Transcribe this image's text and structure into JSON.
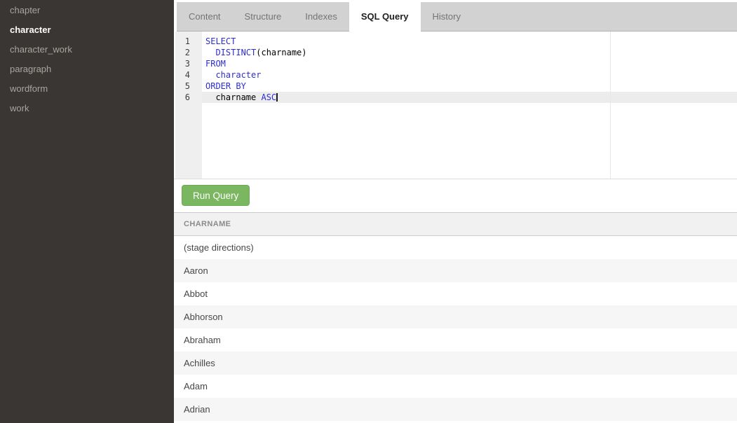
{
  "sidebar": {
    "items": [
      {
        "label": "chapter",
        "selected": false
      },
      {
        "label": "character",
        "selected": true
      },
      {
        "label": "character_work",
        "selected": false
      },
      {
        "label": "paragraph",
        "selected": false
      },
      {
        "label": "wordform",
        "selected": false
      },
      {
        "label": "work",
        "selected": false
      }
    ]
  },
  "tabs": {
    "items": [
      "Content",
      "Structure",
      "Indexes",
      "SQL Query",
      "History"
    ],
    "active": "SQL Query"
  },
  "editor": {
    "lines": [
      {
        "number": "1",
        "active": false,
        "cursor": false,
        "tokens": [
          {
            "text": "SELECT",
            "type": "keyword"
          }
        ]
      },
      {
        "number": "2",
        "active": false,
        "cursor": false,
        "tokens": [
          {
            "text": "  ",
            "type": "plain"
          },
          {
            "text": "DISTINCT",
            "type": "keyword"
          },
          {
            "text": "(charname)",
            "type": "plain"
          }
        ]
      },
      {
        "number": "3",
        "active": false,
        "cursor": false,
        "tokens": [
          {
            "text": "FROM",
            "type": "keyword"
          }
        ]
      },
      {
        "number": "4",
        "active": false,
        "cursor": false,
        "tokens": [
          {
            "text": "  ",
            "type": "plain"
          },
          {
            "text": "character",
            "type": "keyword"
          }
        ]
      },
      {
        "number": "5",
        "active": false,
        "cursor": false,
        "tokens": [
          {
            "text": "ORDER BY",
            "type": "keyword"
          }
        ]
      },
      {
        "number": "6",
        "active": true,
        "cursor": true,
        "tokens": [
          {
            "text": "  ",
            "type": "plain"
          },
          {
            "text": "charname ",
            "type": "plain"
          },
          {
            "text": "ASC",
            "type": "keyword"
          }
        ]
      }
    ]
  },
  "run_button": {
    "label": "Run Query"
  },
  "results": {
    "columns": [
      "CHARNAME"
    ],
    "rows": [
      "(stage directions)",
      "Aaron",
      "Abbot",
      "Abhorson",
      "Abraham",
      "Achilles",
      "Adam",
      "Adrian"
    ]
  },
  "colors": {
    "accent_green": "#7BB661",
    "keyword_blue": "#2E2ECE",
    "sidebar_bg": "#3A3633",
    "tabbar_bg": "#D2D2D2",
    "active_line_bg": "#ECECEC"
  }
}
